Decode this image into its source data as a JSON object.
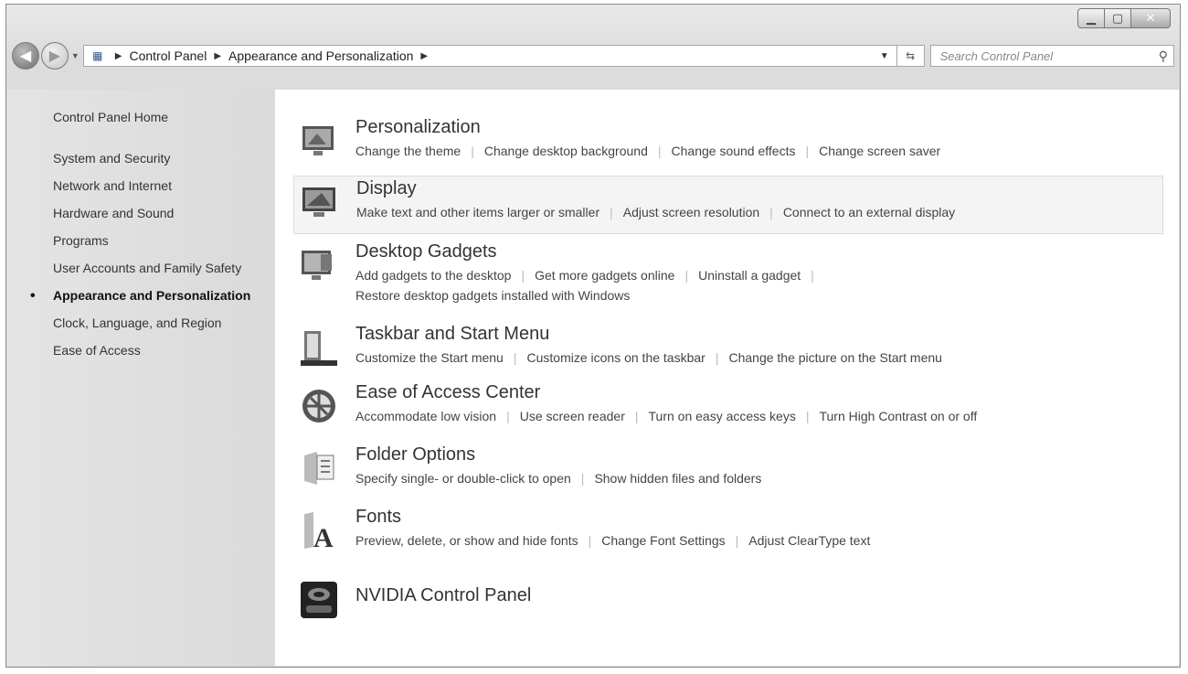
{
  "address": {
    "crumbs": [
      "Control Panel",
      "Appearance and Personalization"
    ]
  },
  "search": {
    "placeholder": "Search Control Panel"
  },
  "sidebar": {
    "home": "Control Panel Home",
    "items": [
      {
        "label": "System and Security"
      },
      {
        "label": "Network and Internet"
      },
      {
        "label": "Hardware and Sound"
      },
      {
        "label": "Programs"
      },
      {
        "label": "User Accounts and Family Safety"
      },
      {
        "label": "Appearance and Personalization"
      },
      {
        "label": "Clock, Language, and Region"
      },
      {
        "label": "Ease of Access"
      }
    ]
  },
  "categories": [
    {
      "title": "Personalization",
      "links": [
        "Change the theme",
        "Change desktop background",
        "Change sound effects",
        "Change screen saver"
      ]
    },
    {
      "title": "Display",
      "links": [
        "Make text and other items larger or smaller",
        "Adjust screen resolution",
        "Connect to an external display"
      ]
    },
    {
      "title": "Desktop Gadgets",
      "links": [
        "Add gadgets to the desktop",
        "Get more gadgets online",
        "Uninstall a gadget"
      ],
      "links2": [
        "Restore desktop gadgets installed with Windows"
      ]
    },
    {
      "title": "Taskbar and Start Menu",
      "links": [
        "Customize the Start menu",
        "Customize icons on the taskbar",
        "Change the picture on the Start menu"
      ]
    },
    {
      "title": "Ease of Access Center",
      "links": [
        "Accommodate low vision",
        "Use screen reader",
        "Turn on easy access keys",
        "Turn High Contrast on or off"
      ]
    },
    {
      "title": "Folder Options",
      "links": [
        "Specify single- or double-click to open",
        "Show hidden files and folders"
      ]
    },
    {
      "title": "Fonts",
      "links": [
        "Preview, delete, or show and hide fonts",
        "Change Font Settings",
        "Adjust ClearType text"
      ]
    },
    {
      "title": "NVIDIA Control Panel",
      "links": []
    }
  ]
}
